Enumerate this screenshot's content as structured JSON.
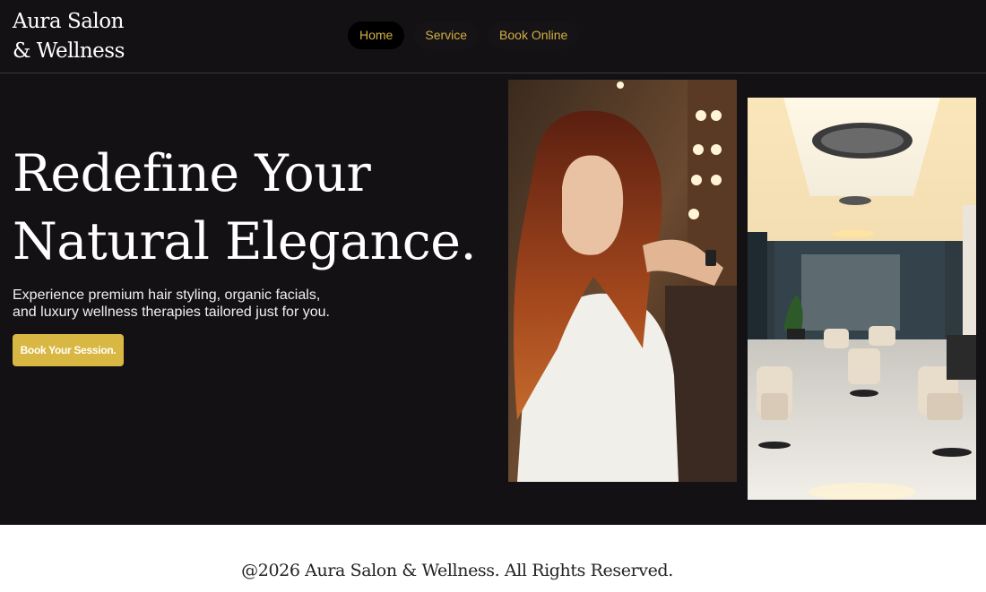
{
  "header": {
    "logo_line1": "Aura Salon",
    "logo_line2": "& Wellness",
    "nav": [
      {
        "label": "Home"
      },
      {
        "label": "Service"
      },
      {
        "label": "Book Online"
      }
    ]
  },
  "hero": {
    "title_line1": "Redefine Your",
    "title_line2": "Natural Elegance.",
    "subtitle_line1": "Experience premium hair styling, organic facials,",
    "subtitle_line2": "and luxury wellness therapies tailored just for you.",
    "cta_label": "Book Your Session."
  },
  "footer": {
    "copyright": "@2026 Aura Salon & Wellness. All Rights Reserved."
  },
  "colors": {
    "background": "#131114",
    "accent": "#d8b843",
    "nav_text": "#d2b043",
    "footer_bg": "#ffffff"
  }
}
